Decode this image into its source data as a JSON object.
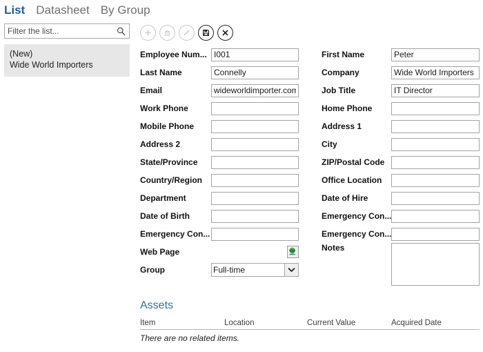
{
  "tabs": [
    {
      "label": "List",
      "active": true
    },
    {
      "label": "Datasheet",
      "active": false
    },
    {
      "label": "By Group",
      "active": false
    }
  ],
  "filter": {
    "placeholder": "Filter the list...",
    "value": "",
    "icon": "search-icon"
  },
  "list": {
    "items": [
      {
        "primary": "(New)",
        "secondary": "Wide World Importers",
        "selected": true
      }
    ]
  },
  "toolbar": {
    "buttons": [
      {
        "name": "add-record-button",
        "icon": "plus-icon",
        "enabled": false
      },
      {
        "name": "delete-record-button",
        "icon": "trash-icon",
        "enabled": false
      },
      {
        "name": "edit-record-button",
        "icon": "pencil-icon",
        "enabled": false
      },
      {
        "name": "save-record-button",
        "icon": "save-icon",
        "enabled": true
      },
      {
        "name": "cancel-record-button",
        "icon": "close-icon",
        "enabled": true
      }
    ]
  },
  "form": {
    "left": [
      {
        "label": "Employee Num...",
        "value": "I001",
        "type": "text"
      },
      {
        "label": "Last Name",
        "value": "Connelly",
        "type": "text"
      },
      {
        "label": "Email",
        "value": "wideworldimporter.com",
        "type": "text"
      },
      {
        "label": "Work Phone",
        "value": "",
        "type": "text"
      },
      {
        "label": "Mobile Phone",
        "value": "",
        "type": "text"
      },
      {
        "label": "Address 2",
        "value": "",
        "type": "text"
      },
      {
        "label": "State/Province",
        "value": "",
        "type": "text"
      },
      {
        "label": "Country/Region",
        "value": "",
        "type": "text"
      },
      {
        "label": "Department",
        "value": "",
        "type": "text"
      },
      {
        "label": "Date of Birth",
        "value": "",
        "type": "text"
      },
      {
        "label": "Emergency Con...",
        "value": "",
        "type": "text"
      },
      {
        "label": "Web Page",
        "value": "",
        "type": "link-button",
        "icon": "globe-icon"
      },
      {
        "label": "Group",
        "value": "Full-time",
        "type": "select",
        "options": [
          "Full-time"
        ]
      }
    ],
    "right": [
      {
        "label": "First Name",
        "value": "Peter",
        "type": "text"
      },
      {
        "label": "Company",
        "value": "Wide World Importers",
        "type": "text"
      },
      {
        "label": "Job Title",
        "value": "IT Director",
        "type": "text"
      },
      {
        "label": "Home Phone",
        "value": "",
        "type": "text"
      },
      {
        "label": "Address 1",
        "value": "",
        "type": "text"
      },
      {
        "label": "City",
        "value": "",
        "type": "text"
      },
      {
        "label": "ZIP/Postal Code",
        "value": "",
        "type": "text"
      },
      {
        "label": "Office Location",
        "value": "",
        "type": "text"
      },
      {
        "label": "Date of Hire",
        "value": "",
        "type": "text"
      },
      {
        "label": "Emergency Con...",
        "value": "",
        "type": "text"
      },
      {
        "label": "Emergency Con...",
        "value": "",
        "type": "text"
      },
      {
        "label": "Notes",
        "value": "",
        "type": "textarea"
      }
    ]
  },
  "assets": {
    "title": "Assets",
    "columns": [
      "Item",
      "Location",
      "Current Value",
      "Acquired Date"
    ],
    "rows": [],
    "empty_text": "There are no related items."
  },
  "colors": {
    "accent_blue": "#1c5f9e",
    "heading_blue": "#2f6fa7",
    "selected_row": "#e7e7e7",
    "field_border": "#a3a3a3"
  }
}
